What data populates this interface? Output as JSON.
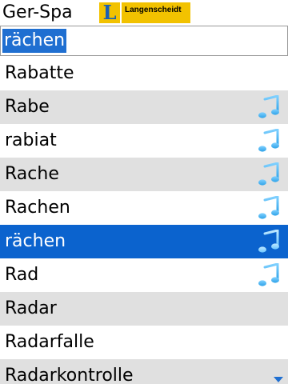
{
  "header": {
    "lang_pair": "Ger-Spa",
    "logo_mark": "L",
    "logo_text": "Langenscheidt"
  },
  "search": {
    "value": "rächen"
  },
  "list": [
    {
      "word": "Rabatte",
      "audio": false
    },
    {
      "word": "Rabe",
      "audio": true
    },
    {
      "word": "rabiat",
      "audio": true
    },
    {
      "word": "Rache",
      "audio": true
    },
    {
      "word": "Rachen",
      "audio": true
    },
    {
      "word": "rächen",
      "audio": true,
      "selected": true
    },
    {
      "word": "Rad",
      "audio": true
    },
    {
      "word": "Radar",
      "audio": false
    },
    {
      "word": "Radarfalle",
      "audio": false
    },
    {
      "word": "Radarkontrolle",
      "audio": false
    }
  ],
  "icons": {
    "audio": "music-note-icon",
    "scroll_up": "scroll-up-arrow-icon",
    "scroll_down": "scroll-down-arrow-icon"
  },
  "colors": {
    "accent": "#0b63ce",
    "row_alt": "#e0e0e0",
    "logo_yellow": "#f2c200",
    "note_blue": "#2fa3e8"
  }
}
